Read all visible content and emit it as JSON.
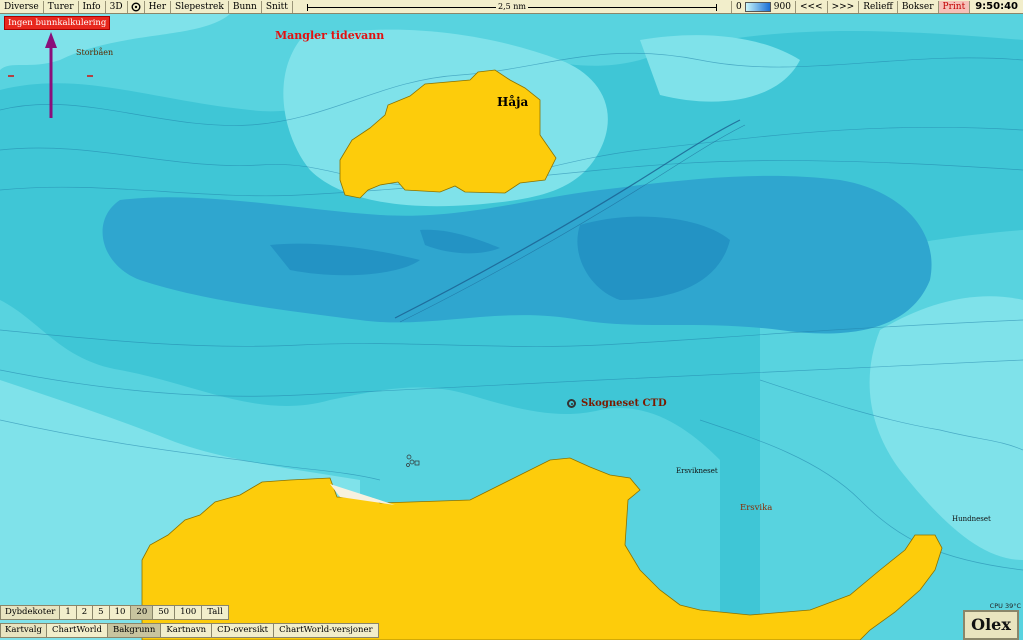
{
  "toolbar": {
    "items": [
      "Diverse",
      "Turer",
      "Info",
      "3D",
      "Her",
      "Slepestrek",
      "Bunn",
      "Snitt"
    ],
    "scale_label": "2,5 nm",
    "depth_min": "0",
    "depth_max": "900",
    "prev2": "<<<",
    "next2": ">>>",
    "relieff": "Relieff",
    "bokser": "Bokser",
    "print": "Print",
    "clock": "9:50:40"
  },
  "map": {
    "warning": "Ingen bunnkalkulering",
    "tide_warning": "Mangler tidevann",
    "places": {
      "storbaen": "Storbåen",
      "haja": "Håja",
      "ctd": "Skogneset CTD",
      "ersvikneset": "Ersvikneset",
      "ersvika": "Ersvika",
      "hundneset": "Hundneset"
    },
    "colors": {
      "land": "#fdcc0b",
      "sea_shallow": "#8fe9ef",
      "sea_mid": "#3fc6d6",
      "sea_deep": "#2fa6cf",
      "arrow": "#8a0f7a"
    }
  },
  "dybdekoter": {
    "label": "Dybdekoter",
    "options": [
      "1",
      "2",
      "5",
      "10",
      "20",
      "50",
      "100",
      "Tall"
    ],
    "selected": "20"
  },
  "kartvalg": {
    "label": "Kartvalg",
    "options": [
      "ChartWorld",
      "Bakgrunn",
      "Kartnavn",
      "CD-oversikt",
      "ChartWorld-versjoner"
    ],
    "selected": "Bakgrunn"
  },
  "status": {
    "cpu": "CPU 39°C",
    "logo": "Olex"
  }
}
